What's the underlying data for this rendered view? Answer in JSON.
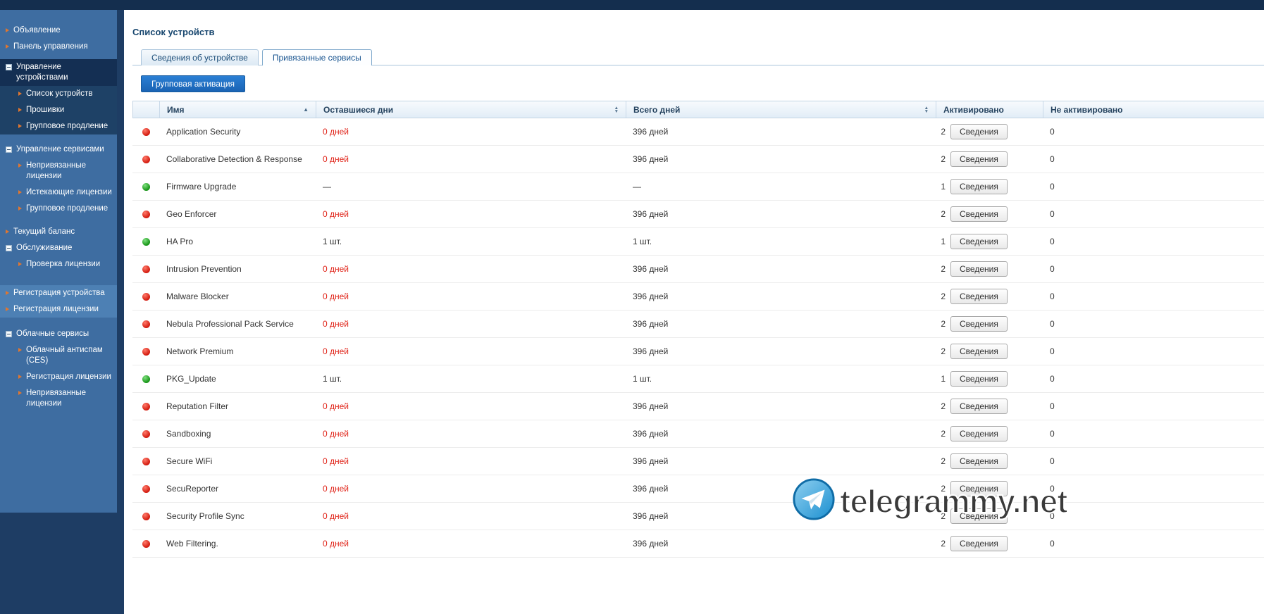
{
  "sidebar": {
    "items": [
      {
        "label": "Объявление",
        "level": 0,
        "kind": "item",
        "section": "normal",
        "gap": 0
      },
      {
        "label": "Панель управления",
        "level": 0,
        "kind": "item",
        "section": "normal",
        "gap": 0
      },
      {
        "label": "Управление устройствами",
        "level": 0,
        "kind": "group",
        "section": "dark",
        "gap": 6
      },
      {
        "label": "Список устройств",
        "level": 1,
        "kind": "item",
        "section": "dark",
        "gap": 0,
        "active": true
      },
      {
        "label": "Прошивки",
        "level": 1,
        "kind": "item",
        "section": "dark",
        "gap": 0
      },
      {
        "label": "Групповое продление",
        "level": 1,
        "kind": "item",
        "section": "dark",
        "gap": 0
      },
      {
        "label": "Управление сервисами",
        "level": 0,
        "kind": "group",
        "section": "normal",
        "gap": 10
      },
      {
        "label": "Непривязанные лицензии",
        "level": 1,
        "kind": "item",
        "section": "normal",
        "gap": 0
      },
      {
        "label": "Истекающие лицензии",
        "level": 1,
        "kind": "item",
        "section": "normal",
        "gap": 0
      },
      {
        "label": "Групповое продление",
        "level": 1,
        "kind": "item",
        "section": "normal",
        "gap": 0
      },
      {
        "label": "Текущий баланс",
        "level": 0,
        "kind": "item",
        "section": "normal",
        "gap": 10
      },
      {
        "label": "Обслуживание",
        "level": 0,
        "kind": "group",
        "section": "normal",
        "gap": 0
      },
      {
        "label": "Проверка лицензии",
        "level": 1,
        "kind": "item",
        "section": "normal",
        "gap": 0
      },
      {
        "label": "Регистрация устройства",
        "level": 0,
        "kind": "item",
        "section": "light",
        "gap": 18
      },
      {
        "label": "Регистрация лицензии",
        "level": 0,
        "kind": "item",
        "section": "light",
        "gap": 0
      },
      {
        "label": "Облачные сервисы",
        "level": 0,
        "kind": "group",
        "section": "normal",
        "gap": 12
      },
      {
        "label": "Облачный антиспам (CES)",
        "level": 1,
        "kind": "item",
        "section": "normal",
        "gap": 0
      },
      {
        "label": "Регистрация лицензии",
        "level": 1,
        "kind": "item",
        "section": "normal",
        "gap": 0
      },
      {
        "label": "Непривязанные лицензии",
        "level": 1,
        "kind": "item",
        "section": "normal",
        "gap": 0
      }
    ]
  },
  "main": {
    "title": "Список устройств",
    "tabs": [
      {
        "label": "Сведения об устройстве",
        "active": false
      },
      {
        "label": "Привязанные сервисы",
        "active": true
      }
    ],
    "group_activation_button": "Групповая активация",
    "table": {
      "columns": [
        {
          "label": "",
          "sort": "none"
        },
        {
          "label": "Имя",
          "sort": "asc"
        },
        {
          "label": "Оставшиеся дни",
          "sort": "both"
        },
        {
          "label": "Всего дней",
          "sort": "both"
        },
        {
          "label": "Активировано",
          "sort": "none"
        },
        {
          "label": "Не активировано",
          "sort": "none"
        }
      ],
      "details_button_label": "Сведения",
      "rows": [
        {
          "status": "red",
          "name": "Application Security",
          "remaining": "0 дней",
          "remaining_alert": true,
          "total": "396 дней",
          "activated": "2",
          "not_activated": "0"
        },
        {
          "status": "red",
          "name": "Collaborative Detection & Response",
          "remaining": "0 дней",
          "remaining_alert": true,
          "total": "396 дней",
          "activated": "2",
          "not_activated": "0"
        },
        {
          "status": "green",
          "name": "Firmware Upgrade",
          "remaining": "—",
          "remaining_alert": false,
          "total": "—",
          "activated": "1",
          "not_activated": "0"
        },
        {
          "status": "red",
          "name": "Geo Enforcer",
          "remaining": "0 дней",
          "remaining_alert": true,
          "total": "396 дней",
          "activated": "2",
          "not_activated": "0"
        },
        {
          "status": "green",
          "name": "HA Pro",
          "remaining": "1 шт.",
          "remaining_alert": false,
          "total": "1 шт.",
          "activated": "1",
          "not_activated": "0"
        },
        {
          "status": "red",
          "name": "Intrusion Prevention",
          "remaining": "0 дней",
          "remaining_alert": true,
          "total": "396 дней",
          "activated": "2",
          "not_activated": "0"
        },
        {
          "status": "red",
          "name": "Malware Blocker",
          "remaining": "0 дней",
          "remaining_alert": true,
          "total": "396 дней",
          "activated": "2",
          "not_activated": "0"
        },
        {
          "status": "red",
          "name": "Nebula Professional Pack Service",
          "remaining": "0 дней",
          "remaining_alert": true,
          "total": "396 дней",
          "activated": "2",
          "not_activated": "0"
        },
        {
          "status": "red",
          "name": "Network Premium",
          "remaining": "0 дней",
          "remaining_alert": true,
          "total": "396 дней",
          "activated": "2",
          "not_activated": "0"
        },
        {
          "status": "green",
          "name": "PKG_Update",
          "remaining": "1 шт.",
          "remaining_alert": false,
          "total": "1 шт.",
          "activated": "1",
          "not_activated": "0"
        },
        {
          "status": "red",
          "name": "Reputation Filter",
          "remaining": "0 дней",
          "remaining_alert": true,
          "total": "396 дней",
          "activated": "2",
          "not_activated": "0"
        },
        {
          "status": "red",
          "name": "Sandboxing",
          "remaining": "0 дней",
          "remaining_alert": true,
          "total": "396 дней",
          "activated": "2",
          "not_activated": "0"
        },
        {
          "status": "red",
          "name": "Secure WiFi",
          "remaining": "0 дней",
          "remaining_alert": true,
          "total": "396 дней",
          "activated": "2",
          "not_activated": "0"
        },
        {
          "status": "red",
          "name": "SecuReporter",
          "remaining": "0 дней",
          "remaining_alert": true,
          "total": "396 дней",
          "activated": "2",
          "not_activated": "0"
        },
        {
          "status": "red",
          "name": "Security Profile Sync",
          "remaining": "0 дней",
          "remaining_alert": true,
          "total": "396 дней",
          "activated": "2",
          "not_activated": "0"
        },
        {
          "status": "red",
          "name": "Web Filtering.",
          "remaining": "0 дней",
          "remaining_alert": true,
          "total": "396 дней",
          "activated": "2",
          "not_activated": "0"
        }
      ]
    }
  },
  "watermark": {
    "text": "telegrammy.net"
  },
  "colors": {
    "accent_blue": "#1d6fc2",
    "alert_red": "#e02318",
    "ok_green": "#129112",
    "sidebar_blue": "#3e6da1",
    "dark_navy": "#142e4e"
  }
}
